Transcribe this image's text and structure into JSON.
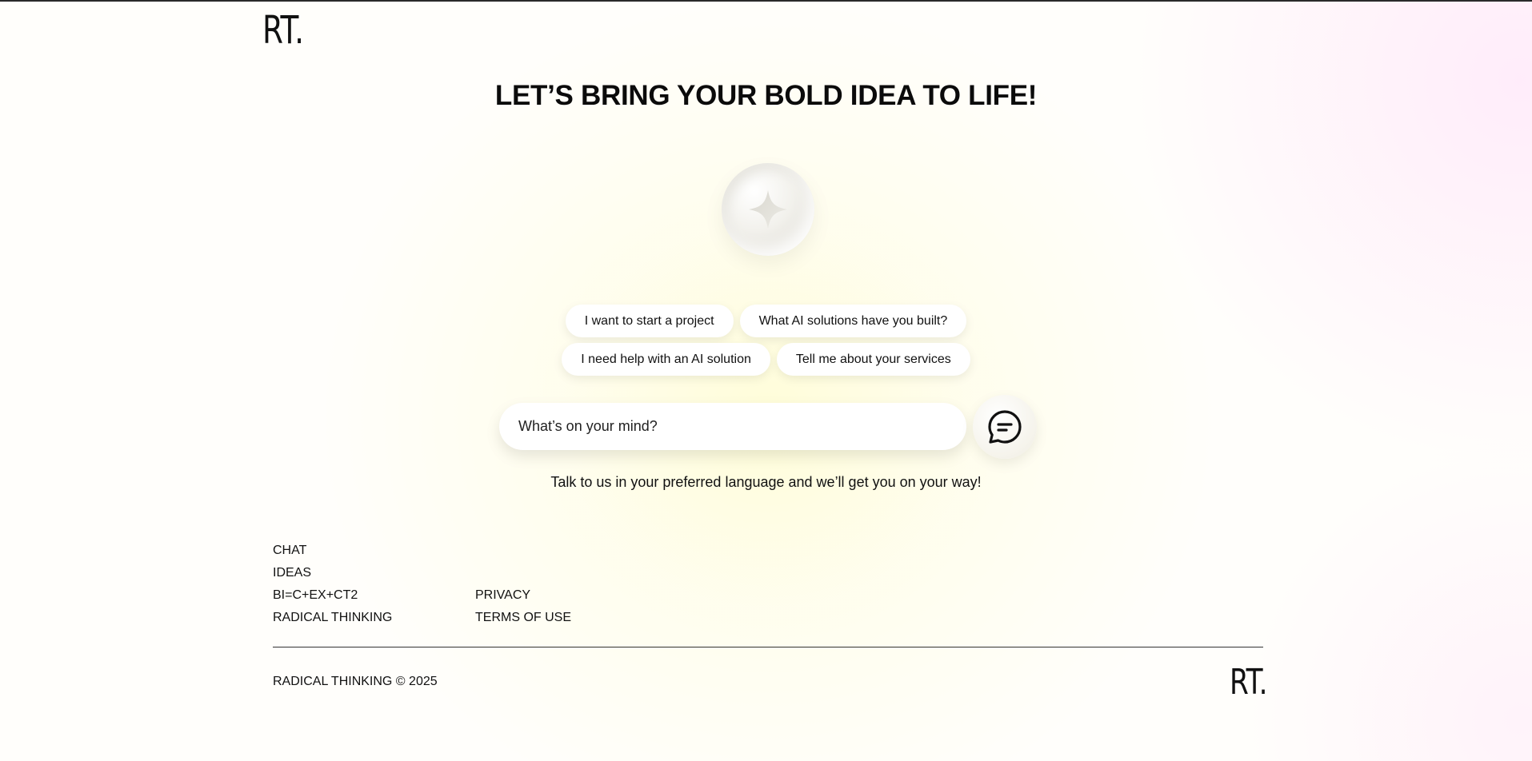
{
  "brand": {
    "logo_text": "RT."
  },
  "hero": {
    "headline": "LET’S BRING YOUR BOLD IDEA TO LIFE!"
  },
  "suggestions": {
    "row1": [
      "I want to start a project",
      "What AI solutions have you built?"
    ],
    "row2": [
      "I need help with an AI solution",
      "Tell me about your services"
    ]
  },
  "chat": {
    "placeholder": "What’s on your mind?",
    "send_icon": "chat-bubble-icon",
    "tagline": "Talk to us in your preferred language and we’ll get you on your way!"
  },
  "footer": {
    "col1": [
      "CHAT",
      "IDEAS",
      "BI=C+EX+CT2",
      "RADICAL THINKING"
    ],
    "col2": [
      "PRIVACY",
      "TERMS OF USE"
    ],
    "copyright": "RADICAL THINKING © 2025"
  },
  "colors": {
    "text": "#111111",
    "glow": "#fffdd7",
    "accent_pink": "#ffe8fa"
  }
}
